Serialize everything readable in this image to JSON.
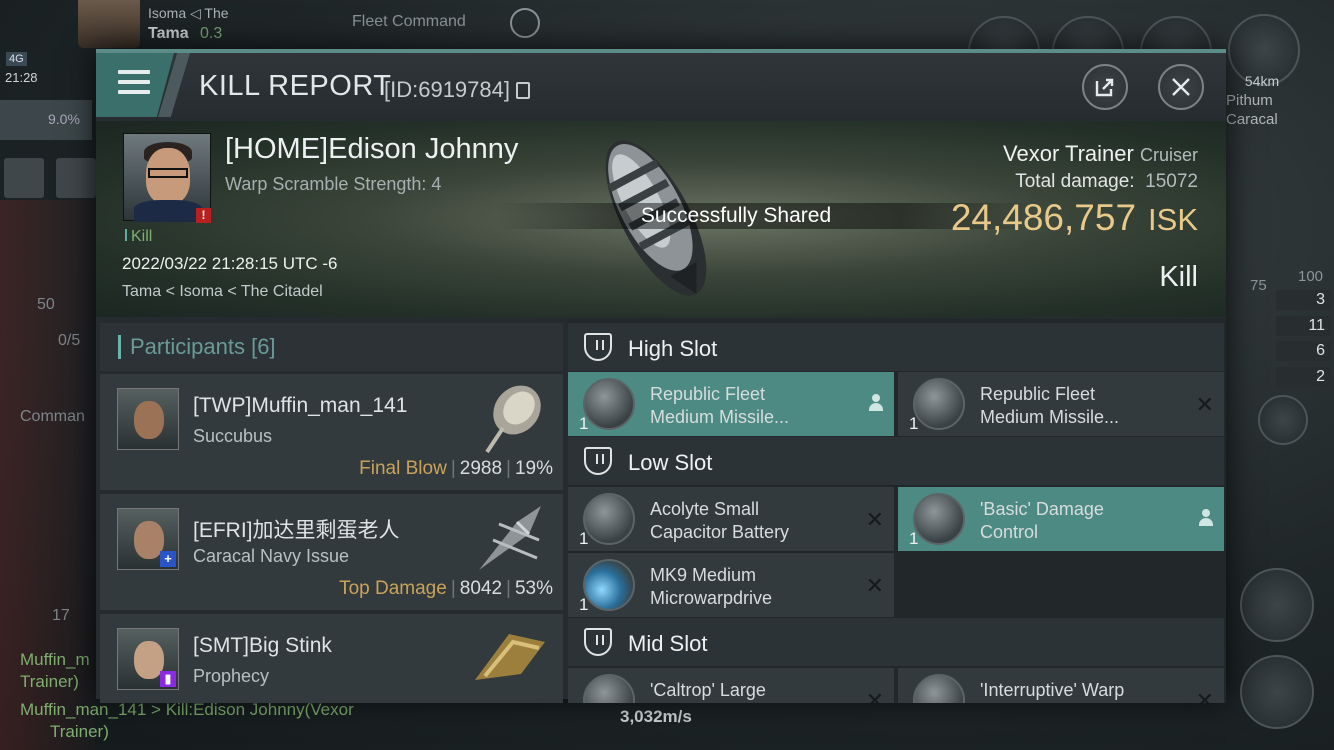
{
  "hud": {
    "player_top": "Isoma  ◁ The",
    "player_name": "Tama",
    "security": "0.3",
    "fleet_label": "Fleet Command",
    "signal": "4G",
    "time": "21:28",
    "cargo": "9.0%",
    "left_nums": [
      "50",
      "0/5"
    ],
    "left_label": "Comman",
    "left_count": "17",
    "chat": [
      "Muffin_m",
      "Trainer)",
      "Muffin_man_141 > Kill:Edison Johnny(Vexor",
      "Trainer)"
    ],
    "speed": "3,032m/s",
    "target_distance": "54km",
    "target_name": "Pithum",
    "target_type": "Caracal",
    "scale": [
      "75",
      "100"
    ],
    "stats": [
      "3",
      "11",
      "6",
      "2"
    ]
  },
  "dialog": {
    "title": "KILL REPORT",
    "id": "[ID:6919784]",
    "victim": {
      "name": "[HOME]Edison Johnny",
      "warp": "Warp Scramble Strength: 4",
      "tag": "Kill",
      "date": "2022/03/22 21:28:15 UTC -6",
      "location": "Tama < Isoma < The Citadel"
    },
    "shared_banner": "Successfully Shared",
    "ship": {
      "name": "Vexor Trainer",
      "class": "Cruiser",
      "damage_label": "Total damage:",
      "damage_value": "15072",
      "isk_value": "24,486,757",
      "isk_unit": "ISK",
      "result": "Kill"
    },
    "participants": {
      "label": "Participants",
      "count": "[6]",
      "rows": [
        {
          "name": "[TWP]Muffin_man_141",
          "ship": "Succubus",
          "tag": "Final Blow",
          "damage": "2988",
          "percent": "19%",
          "corp_color": "#000000",
          "corp_symbol": ""
        },
        {
          "name": "[EFRI]加达里剩蛋老人",
          "ship": "Caracal Navy Issue",
          "tag": "Top Damage",
          "damage": "8042",
          "percent": "53%",
          "corp_color": "#2a55c8",
          "corp_symbol": "+"
        },
        {
          "name": "[SMT]Big Stink",
          "ship": "Prophecy",
          "tag": "",
          "damage": "",
          "percent": "",
          "corp_color": "#8a2be2",
          "corp_symbol": "▮"
        }
      ]
    },
    "fitting": {
      "high_slot": "High Slot",
      "low_slot": "Low Slot",
      "mid_slot": "Mid Slot",
      "high": [
        {
          "qty": "1",
          "line1": "Republic Fleet",
          "line2": "Medium Missile...",
          "state": "pilot"
        },
        {
          "qty": "1",
          "line1": "Republic Fleet",
          "line2": "Medium Missile...",
          "state": "destroyed"
        }
      ],
      "low": [
        {
          "qty": "1",
          "line1": "Acolyte Small",
          "line2": "Capacitor Battery",
          "state": "destroyed"
        },
        {
          "qty": "1",
          "line1": "'Basic' Damage",
          "line2": "Control",
          "state": "pilot"
        },
        {
          "qty": "1",
          "line1": "MK9 Medium",
          "line2": "Microwarpdrive",
          "state": "destroyed"
        }
      ],
      "mid": [
        {
          "qty": "",
          "line1": "'Caltrop' Large",
          "line2": "",
          "state": "destroyed"
        },
        {
          "qty": "",
          "line1": "'Interruptive' Warp",
          "line2": "",
          "state": "destroyed"
        }
      ]
    }
  }
}
